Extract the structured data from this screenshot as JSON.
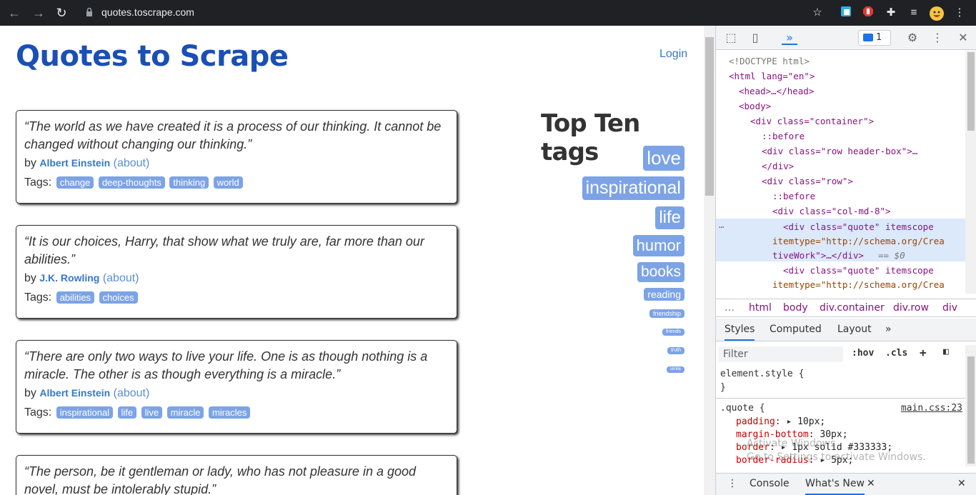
{
  "browser": {
    "url": "quotes.toscrape.com",
    "back_icon": "arrow-left",
    "forward_icon": "arrow-right",
    "reload_icon": "reload"
  },
  "site": {
    "title": "Quotes to Scrape",
    "login": "Login",
    "quotes": [
      {
        "text": "“The world as we have created it is a process of our thinking. It cannot be changed without changing our thinking.”",
        "by": "by",
        "author": "Albert Einstein",
        "about": "(about)",
        "tags_label": "Tags:",
        "tags": [
          "change",
          "deep-thoughts",
          "thinking",
          "world"
        ]
      },
      {
        "text": "“It is our choices, Harry, that show what we truly are, far more than our abilities.”",
        "by": "by",
        "author": "J.K. Rowling",
        "about": "(about)",
        "tags_label": "Tags:",
        "tags": [
          "abilities",
          "choices"
        ]
      },
      {
        "text": "“There are only two ways to live your life. One is as though nothing is a miracle. The other is as though everything is a miracle.”",
        "by": "by",
        "author": "Albert Einstein",
        "about": "(about)",
        "tags_label": "Tags:",
        "tags": [
          "inspirational",
          "life",
          "live",
          "miracle",
          "miracles"
        ]
      },
      {
        "text": "“The person, be it gentleman or lady, who has not pleasure in a good novel, must be intolerably stupid.”"
      }
    ],
    "top_tags_title": "Top Ten tags",
    "top_tags": [
      "love",
      "inspirational",
      "life",
      "humor",
      "books",
      "reading",
      "friendship",
      "friends",
      "truth",
      "simile"
    ]
  },
  "devtools": {
    "issues_count": "1",
    "elements": [
      "<!DOCTYPE html>",
      "<html lang=\"en\">",
      "<head>…</head>",
      "<body>",
      "<div class=\"container\">",
      "::before",
      "<div class=\"row header-box\">…",
      "</div>",
      "<div class=\"row\">",
      "::before",
      "<div class=\"col-md-8\">"
    ],
    "selected_line_1": "<div class=\"quote\" itemscope",
    "selected_line_2": "itemtype=\"http://schema.org/Crea",
    "selected_line_3": "tiveWork\">…</div>",
    "selected_suffix": "== $0",
    "next_line_1": "<div class=\"quote\" itemscope",
    "next_line_2": "itemtype=\"http://schema.org/Crea",
    "breadcrumbs": [
      "…",
      "html",
      "body",
      "div.container",
      "div.row",
      "div"
    ],
    "style_tabs": [
      "Styles",
      "Computed",
      "Layout"
    ],
    "filter_placeholder": "Filter",
    "hov": ":hov",
    "cls": ".cls",
    "element_style": "element.style {",
    "close_brace": "}",
    "rule_selector": ".quote {",
    "rule_source": "main.css:23",
    "rules": [
      {
        "prop": "padding",
        "value": "10px;"
      },
      {
        "prop": "margin-bottom",
        "value": "30px;"
      },
      {
        "prop": "border",
        "value": "1px solid #333333;"
      },
      {
        "prop": "border-radius",
        "value": "5px;"
      }
    ],
    "drawer_tabs": [
      "Console",
      "What's New"
    ]
  },
  "watermark": {
    "line1": "Activate Windows",
    "line2": "Go to Settings to activate Windows."
  },
  "colors": {
    "link_blue": "#3677c8",
    "title_blue": "#1a4fb5",
    "tag_bg": "#7ca3e6",
    "chrome_bg": "#202124"
  }
}
